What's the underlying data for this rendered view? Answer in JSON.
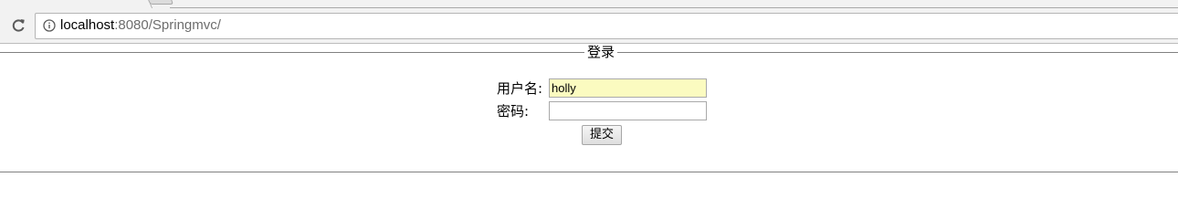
{
  "browser": {
    "tab": {
      "title": ""
    },
    "address_bar": {
      "host": "localhost",
      "rest": ":8080/Springmvc/"
    }
  },
  "form": {
    "legend": "登录",
    "username": {
      "label": "用户名:",
      "value": "holly"
    },
    "password": {
      "label": "密码:",
      "value": ""
    },
    "submit_label": "提交"
  },
  "colors": {
    "autofill_background": "#fbfbc0",
    "fieldset_border": "#808080"
  }
}
